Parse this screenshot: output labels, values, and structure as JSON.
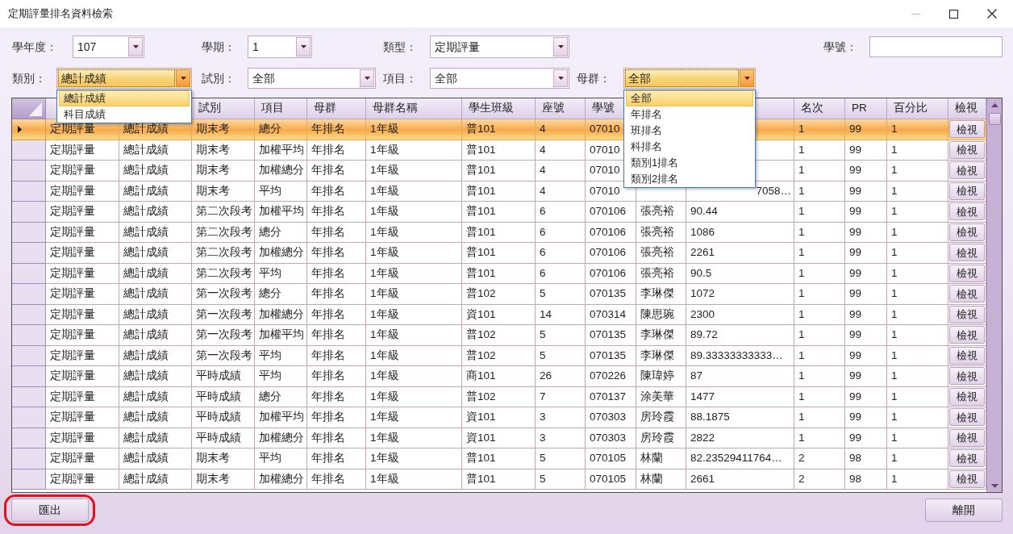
{
  "window": {
    "title": "定期評量排名資料檢索",
    "controls": [
      {
        "kind": "minimize",
        "disabled": true
      },
      {
        "kind": "maximize",
        "disabled": false
      },
      {
        "kind": "close",
        "disabled": false
      }
    ]
  },
  "filters": [
    [
      {
        "kind": "combo",
        "label": "學年度：",
        "value": "107",
        "expanded": false
      },
      {
        "kind": "combo",
        "label": "學期：",
        "value": "1",
        "expanded": false
      },
      {
        "kind": "combo",
        "label": "類型：",
        "value": "定期評量",
        "expanded": false
      },
      {
        "kind": "text",
        "label": "學號："
      }
    ],
    [
      {
        "kind": "combo",
        "label": "類別：",
        "value": "總計成績",
        "expanded": true,
        "options": [
          {
            "label": "總計成績",
            "selected": true
          },
          {
            "label": "科目成績",
            "selected": false
          }
        ]
      },
      {
        "kind": "combo",
        "label": "試別：",
        "value": "全部",
        "expanded": false
      },
      {
        "kind": "combo",
        "label": "項目：",
        "value": "全部",
        "expanded": false
      },
      {
        "kind": "combo",
        "label": "母群：",
        "value": "全部",
        "expanded": true,
        "options": [
          {
            "label": "全部",
            "selected": true
          },
          {
            "label": "年排名",
            "selected": false
          },
          {
            "label": "班排名",
            "selected": false
          },
          {
            "label": "科排名",
            "selected": false
          },
          {
            "label": "類別1排名",
            "selected": false
          },
          {
            "label": "類別2排名",
            "selected": false
          }
        ]
      }
    ]
  ],
  "table": {
    "columns": [
      null,
      null,
      "試別",
      "項目",
      "母群",
      "母群名稱",
      "學生班級",
      "座號",
      "學號",
      null,
      null,
      "名次",
      "PR",
      "百分比",
      "檢視"
    ],
    "rows": [
      {
        "selected": true,
        "cells": [
          "定期評量",
          "總計成績",
          "期末考",
          "總分",
          "年排名",
          "1年級",
          "普101",
          "4",
          "07010",
          null,
          null,
          "1",
          "99",
          "1"
        ],
        "button": "檢視"
      },
      {
        "selected": false,
        "cells": [
          "定期評量",
          "總計成績",
          "期末考",
          "加權平均",
          "年排名",
          "1年級",
          "普101",
          "4",
          "07010",
          null,
          null,
          "1",
          "99",
          "1"
        ],
        "button": "檢視"
      },
      {
        "selected": false,
        "cells": [
          "定期評量",
          "總計成績",
          "期末考",
          "加權總分",
          "年排名",
          "1年級",
          "普101",
          "4",
          "07010",
          null,
          null,
          "1",
          "99",
          "1"
        ],
        "button": "檢視"
      },
      {
        "selected": false,
        "cells": [
          "定期評量",
          "總計成績",
          "期末考",
          "平均",
          "年排名",
          "1年級",
          "普101",
          "4",
          "07010",
          null,
          {
            "text": "7058…",
            "kind": "clipped"
          },
          "1",
          "99",
          "1"
        ],
        "button": "檢視"
      },
      {
        "selected": false,
        "cells": [
          "定期評量",
          "總計成績",
          "第二次段考",
          "加權平均",
          "年排名",
          "1年級",
          "普101",
          "6",
          "070106",
          "張亮裕",
          "90.44",
          "1",
          "99",
          "1"
        ],
        "button": "檢視"
      },
      {
        "selected": false,
        "cells": [
          "定期評量",
          "總計成績",
          "第二次段考",
          "總分",
          "年排名",
          "1年級",
          "普101",
          "6",
          "070106",
          "張亮裕",
          "1086",
          "1",
          "99",
          "1"
        ],
        "button": "檢視"
      },
      {
        "selected": false,
        "cells": [
          "定期評量",
          "總計成績",
          "第二次段考",
          "加權總分",
          "年排名",
          "1年級",
          "普101",
          "6",
          "070106",
          "張亮裕",
          "2261",
          "1",
          "99",
          "1"
        ],
        "button": "檢視"
      },
      {
        "selected": false,
        "cells": [
          "定期評量",
          "總計成績",
          "第二次段考",
          "平均",
          "年排名",
          "1年級",
          "普101",
          "6",
          "070106",
          "張亮裕",
          "90.5",
          "1",
          "99",
          "1"
        ],
        "button": "檢視"
      },
      {
        "selected": false,
        "cells": [
          "定期評量",
          "總計成績",
          "第一次段考",
          "總分",
          "年排名",
          "1年級",
          "普102",
          "5",
          "070135",
          "李琳傑",
          "1072",
          "1",
          "99",
          "1"
        ],
        "button": "檢視"
      },
      {
        "selected": false,
        "cells": [
          "定期評量",
          "總計成績",
          "第一次段考",
          "加權總分",
          "年排名",
          "1年級",
          "資101",
          "14",
          "070314",
          "陳思琬",
          "2300",
          "1",
          "99",
          "1"
        ],
        "button": "檢視"
      },
      {
        "selected": false,
        "cells": [
          "定期評量",
          "總計成績",
          "第一次段考",
          "加權平均",
          "年排名",
          "1年級",
          "普102",
          "5",
          "070135",
          "李琳傑",
          "89.72",
          "1",
          "99",
          "1"
        ],
        "button": "檢視"
      },
      {
        "selected": false,
        "cells": [
          "定期評量",
          "總計成績",
          "第一次段考",
          "平均",
          "年排名",
          "1年級",
          "普102",
          "5",
          "070135",
          "李琳傑",
          "89.33333333333…",
          "1",
          "99",
          "1"
        ],
        "button": "檢視"
      },
      {
        "selected": false,
        "cells": [
          "定期評量",
          "總計成績",
          "平時成績",
          "平均",
          "年排名",
          "1年級",
          "商101",
          "26",
          "070226",
          "陳瑋婷",
          "87",
          "1",
          "99",
          "1"
        ],
        "button": "檢視"
      },
      {
        "selected": false,
        "cells": [
          "定期評量",
          "總計成績",
          "平時成績",
          "總分",
          "年排名",
          "1年級",
          "普102",
          "7",
          "070137",
          "涂美華",
          "1477",
          "1",
          "99",
          "1"
        ],
        "button": "檢視"
      },
      {
        "selected": false,
        "cells": [
          "定期評量",
          "總計成績",
          "平時成績",
          "加權平均",
          "年排名",
          "1年級",
          "資101",
          "3",
          "070303",
          "房玲霞",
          "88.1875",
          "1",
          "99",
          "1"
        ],
        "button": "檢視"
      },
      {
        "selected": false,
        "cells": [
          "定期評量",
          "總計成績",
          "平時成績",
          "加權總分",
          "年排名",
          "1年級",
          "資101",
          "3",
          "070303",
          "房玲霞",
          "2822",
          "1",
          "99",
          "1"
        ],
        "button": "檢視"
      },
      {
        "selected": false,
        "cells": [
          "定期評量",
          "總計成績",
          "期末考",
          "平均",
          "年排名",
          "1年級",
          "普101",
          "5",
          "070105",
          "林蘭",
          "82.23529411764…",
          "2",
          "98",
          "1"
        ],
        "button": "檢視"
      },
      {
        "selected": false,
        "cells": [
          "定期評量",
          "總計成績",
          "期末考",
          "加權總分",
          "年排名",
          "1年級",
          "普101",
          "5",
          "070105",
          "林蘭",
          "2661",
          "2",
          "98",
          "1"
        ],
        "button": "檢視"
      }
    ]
  },
  "buttons": [
    {
      "label": "匯出",
      "highlighted": true
    },
    {
      "label": "離開",
      "highlighted": false
    }
  ]
}
